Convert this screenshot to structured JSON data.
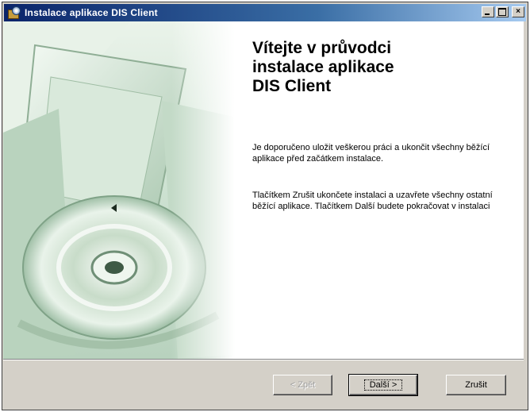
{
  "window": {
    "title": "Instalace aplikace DIS Client",
    "controls": {
      "minimize": "_",
      "maximize": "□",
      "close": "×"
    }
  },
  "welcome": {
    "title": "Vítejte v průvodci\ninstalace aplikace\nDIS Client",
    "paragraph1": "Je doporučeno uložit veškerou práci a ukončit všechny běžící aplikace před začátkem instalace.",
    "paragraph2": "Tlačítkem Zrušit ukončete instalaci a uzavřete všechny ostatní běžící aplikace. Tlačítkem Další budete pokračovat v instalaci"
  },
  "buttons": {
    "back": "< Zpět",
    "next": "Další >",
    "cancel": "Zrušit"
  },
  "colors": {
    "titlebar_start": "#0a246a",
    "titlebar_end": "#a6caf0",
    "dialog_face": "#d4d0c8",
    "art_tint": "#cfe3d3"
  }
}
